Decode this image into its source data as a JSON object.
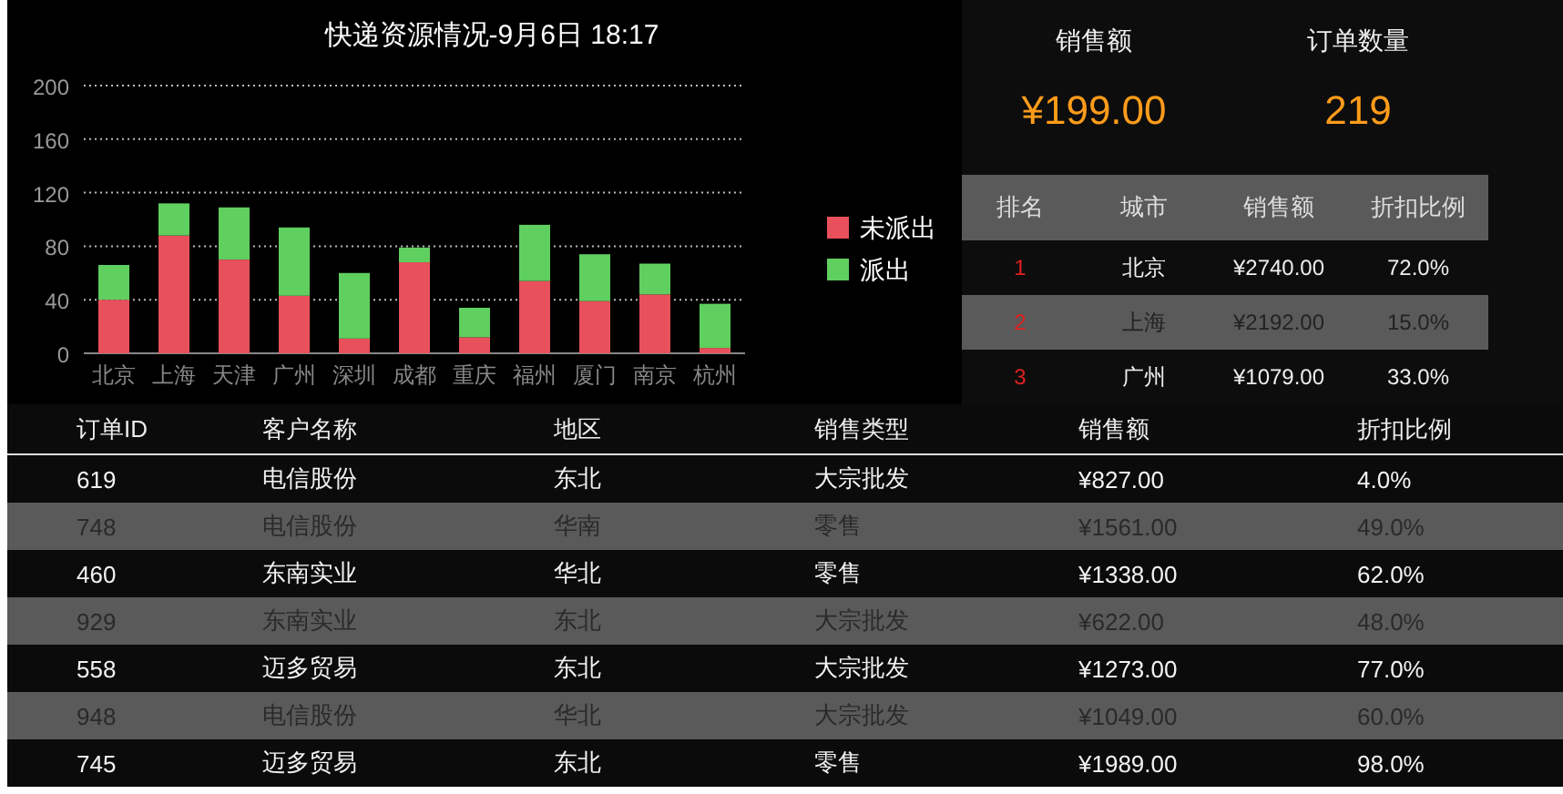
{
  "chart": {
    "title": "快递资源情况-9月6日 18:17",
    "chart_data": {
      "type": "bar",
      "stacked": true,
      "categories": [
        "北京",
        "上海",
        "天津",
        "广州",
        "深圳",
        "成都",
        "重庆",
        "福州",
        "厦门",
        "南京",
        "杭州"
      ],
      "series": [
        {
          "name": "未派出",
          "color": "#e8505b",
          "values": [
            40,
            88,
            70,
            43,
            11,
            68,
            12,
            54,
            39,
            44,
            4
          ]
        },
        {
          "name": "派出",
          "color": "#5fcf5f",
          "values": [
            26,
            24,
            39,
            51,
            49,
            11,
            22,
            42,
            35,
            23,
            33
          ]
        }
      ],
      "grid": true,
      "legend": true,
      "ylim": [
        0,
        200
      ],
      "yticks": [
        0,
        40,
        80,
        120,
        160,
        200
      ]
    }
  },
  "kpis": [
    {
      "label": "销售额",
      "value": "¥199.00"
    },
    {
      "label": "订单数量",
      "value": "219"
    }
  ],
  "ranking": {
    "columns": [
      "排名",
      "城市",
      "销售额",
      "折扣比例"
    ],
    "rows": [
      [
        "1",
        "北京",
        "¥2740.00",
        "72.0%"
      ],
      [
        "2",
        "上海",
        "¥2192.00",
        "15.0%"
      ],
      [
        "3",
        "广州",
        "¥1079.00",
        "33.0%"
      ]
    ]
  },
  "orders": {
    "columns": [
      "订单ID",
      "客户名称",
      "地区",
      "销售类型",
      "销售额",
      "折扣比例"
    ],
    "rows": [
      [
        "619",
        "电信股份",
        "东北",
        "大宗批发",
        "¥827.00",
        "4.0%"
      ],
      [
        "748",
        "电信股份",
        "华南",
        "零售",
        "¥1561.00",
        "49.0%"
      ],
      [
        "460",
        "东南实业",
        "华北",
        "零售",
        "¥1338.00",
        "62.0%"
      ],
      [
        "929",
        "东南实业",
        "东北",
        "大宗批发",
        "¥622.00",
        "48.0%"
      ],
      [
        "558",
        "迈多贸易",
        "东北",
        "大宗批发",
        "¥1273.00",
        "77.0%"
      ],
      [
        "948",
        "电信股份",
        "华北",
        "大宗批发",
        "¥1049.00",
        "60.0%"
      ],
      [
        "745",
        "迈多贸易",
        "东北",
        "零售",
        "¥1989.00",
        "98.0%"
      ]
    ]
  }
}
